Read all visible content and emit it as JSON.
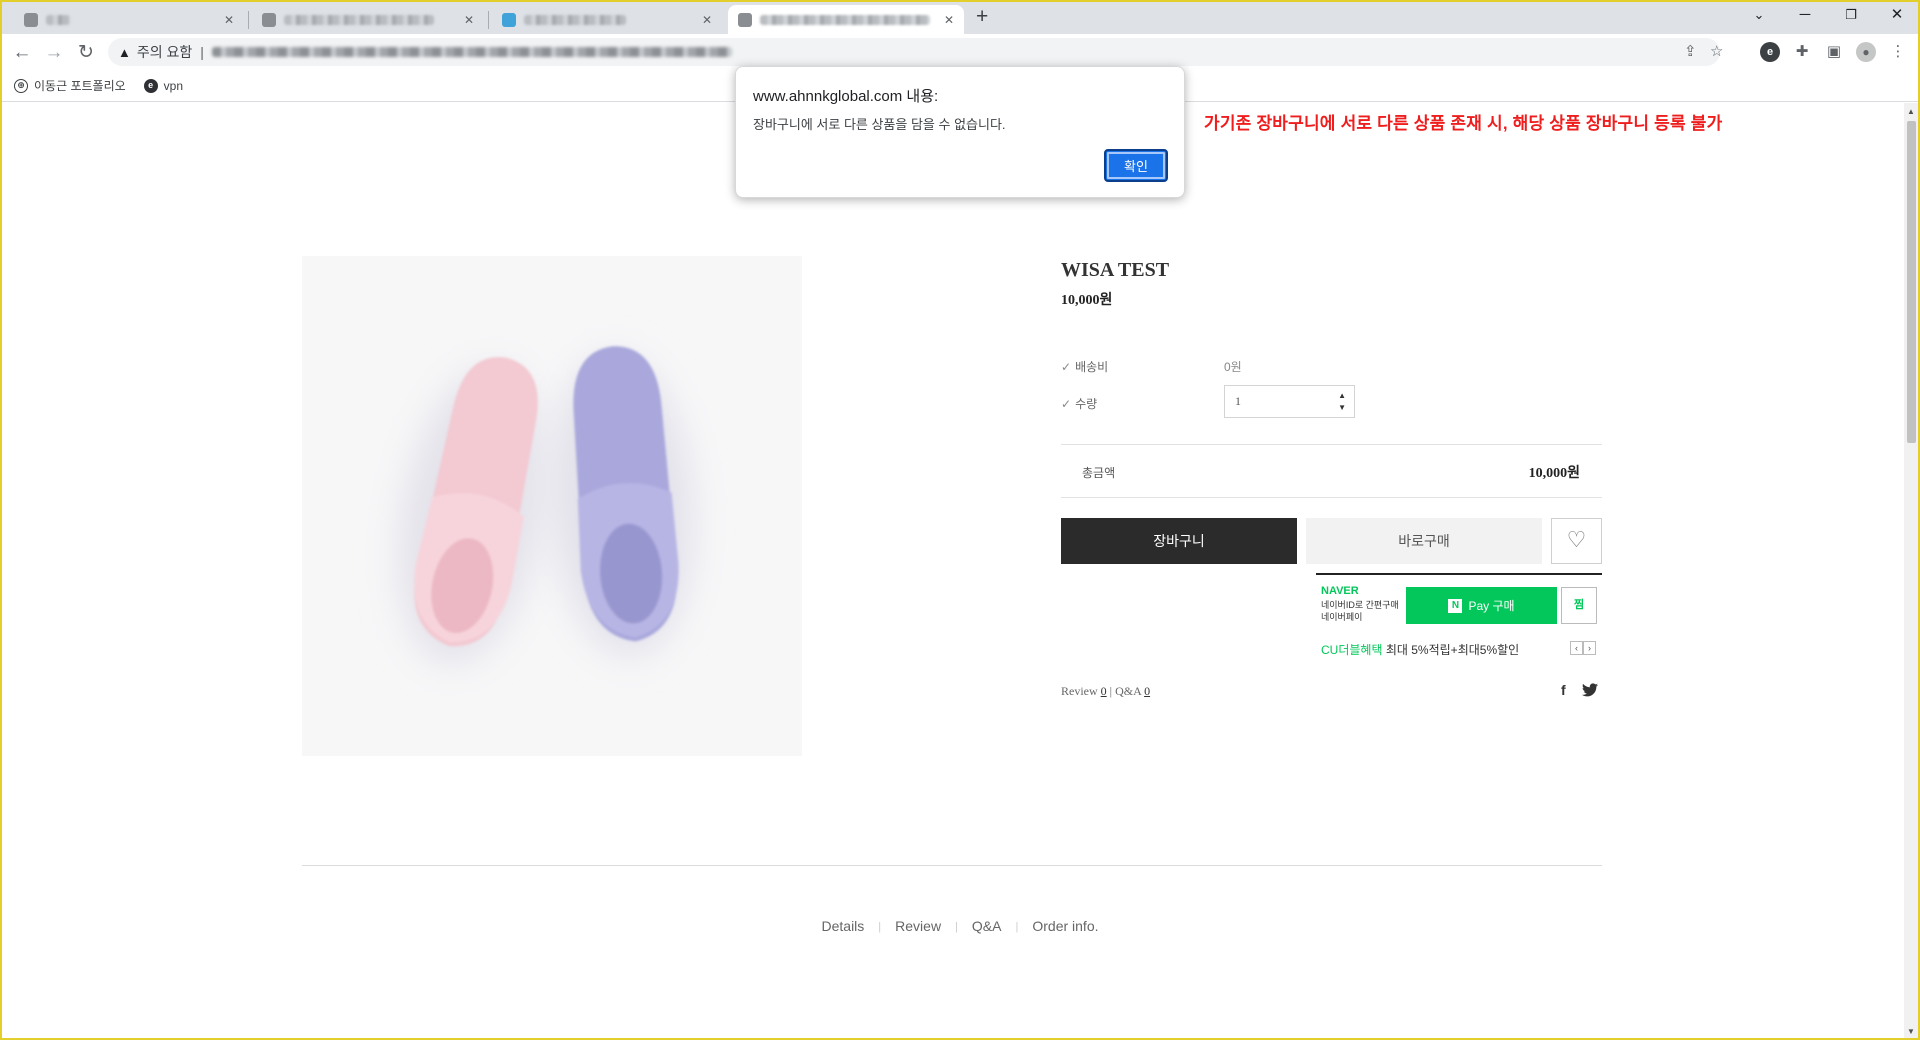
{
  "browser": {
    "tabs": [
      {
        "title": "",
        "active": false
      },
      {
        "title": "",
        "active": false
      },
      {
        "title": "",
        "active": false
      },
      {
        "title": "",
        "active": true
      }
    ],
    "new_tab_label": "+",
    "security_label": "주의 요함",
    "url": "",
    "bookmarks": [
      {
        "label": "이동근 포트폴리오",
        "icon": "globe-icon"
      },
      {
        "label": "vpn",
        "icon": "e-icon"
      }
    ]
  },
  "annotation": "가기존 장바구니에 서로 다른 상품 존재 시, 해당 상품 장바구니 등록 불가",
  "dialog": {
    "title": "www.ahnnkglobal.com 내용:",
    "message": "장바구니에 서로 다른 상품을 담을 수 없습니다.",
    "ok_label": "확인"
  },
  "product": {
    "name": "WISA TEST",
    "price": "10,000원",
    "shipping_label": "배송비",
    "shipping_value": "0원",
    "quantity_label": "수량",
    "quantity_value": "1",
    "total_label": "총금액",
    "total_value": "10,000원",
    "cart_button": "장바구니",
    "buy_button": "바로구매"
  },
  "naver_pay": {
    "brand": "NAVER",
    "desc_line1": "네이버ID로 간편구매",
    "desc_line2": "네이버페이",
    "pay_button": "Pay 구매",
    "pay_logo": "N",
    "zzim_button": "찜",
    "benefit_highlight": "CU더블혜택",
    "benefit_text": "최대 5%적립+최대5%할인",
    "prev": "‹",
    "next": "›"
  },
  "reviews": {
    "review_label": "Review",
    "review_count": "0",
    "qna_label": "Q&A",
    "qna_count": "0"
  },
  "social": {
    "facebook": "f",
    "twitter": "🐦"
  },
  "detail_tabs": [
    "Details",
    "Review",
    "Q&A",
    "Order info."
  ],
  "colors": {
    "naver_green": "#03c75a",
    "annotation_red": "#ef1e1e",
    "cart_button_bg": "#2b2b2b",
    "dialog_button_blue": "#1a73e8"
  }
}
